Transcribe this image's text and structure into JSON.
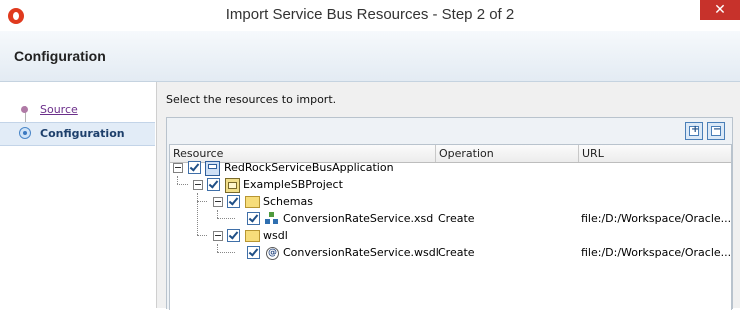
{
  "window": {
    "title": "Import Service Bus Resources - Step 2 of 2",
    "close_glyph": "✕"
  },
  "header": {
    "title": "Configuration"
  },
  "nav": {
    "items": [
      {
        "label": "Source",
        "state": "visited"
      },
      {
        "label": "Configuration",
        "state": "current"
      }
    ]
  },
  "main": {
    "instructions": "Select the resources to import.",
    "toolbar": {
      "expand_glyph": "+",
      "collapse_glyph": "−"
    },
    "columns": [
      "Resource",
      "Operation",
      "URL"
    ],
    "rows": [
      {
        "name": "RedRockServiceBusApplication",
        "operation": "",
        "url": "",
        "icon": "application-icon",
        "checked": true,
        "level": 0
      },
      {
        "name": "ExampleSBProject",
        "operation": "",
        "url": "",
        "icon": "project-icon",
        "checked": true,
        "level": 1
      },
      {
        "name": "Schemas",
        "operation": "",
        "url": "",
        "icon": "folder-icon",
        "checked": true,
        "level": 2
      },
      {
        "name": "ConversionRateService.xsd",
        "operation": "Create",
        "url": "file:/D:/Workspace/Oracle...",
        "icon": "xsd-icon",
        "checked": true,
        "level": 3
      },
      {
        "name": "wsdl",
        "operation": "",
        "url": "",
        "icon": "folder-icon",
        "checked": true,
        "level": 2
      },
      {
        "name": "ConversionRateService.wsdl",
        "operation": "Create",
        "url": "file:/D:/Workspace/Oracle...",
        "icon": "wsdl-icon",
        "checked": true,
        "level": 3
      }
    ]
  },
  "colors": {
    "header_band": "#e3ebf3",
    "nav_selected": "#e2ecf7",
    "close_button": "#c7322b",
    "checkbox_border": "#3f6fa8"
  }
}
